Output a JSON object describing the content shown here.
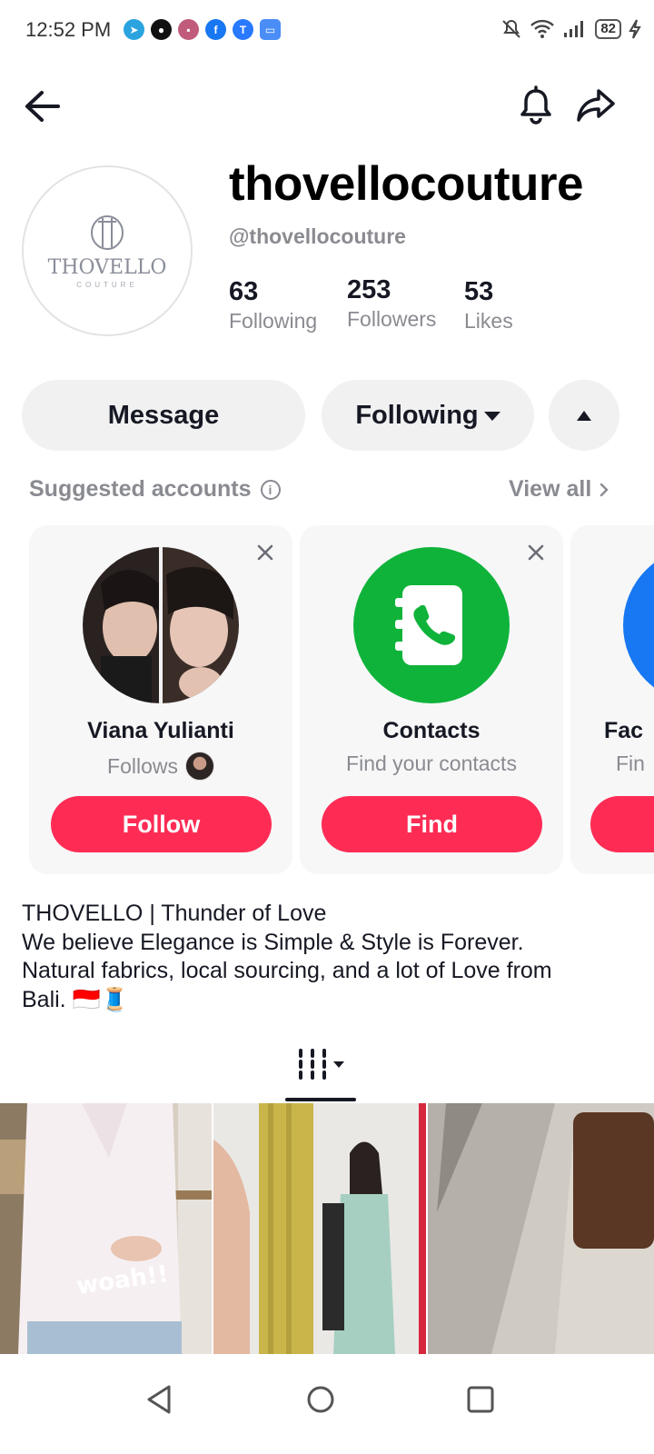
{
  "status_bar": {
    "time": "12:52 PM",
    "battery": "82",
    "apps": [
      {
        "icon": "telegram-icon",
        "color": "#2aa3df",
        "glyph": "➤"
      },
      {
        "icon": "app-icon",
        "color": "#111111",
        "glyph": "●"
      },
      {
        "icon": "app-icon",
        "color": "#c05b7b",
        "glyph": "▪"
      },
      {
        "icon": "facebook-icon",
        "color": "#1877f2",
        "glyph": "f"
      },
      {
        "icon": "app-icon",
        "color": "#2979ff",
        "glyph": "T"
      },
      {
        "icon": "app-icon",
        "color": "#4a8df6",
        "glyph": "▭"
      }
    ]
  },
  "profile": {
    "logo_mark": "ⓘ",
    "logo_name": "THOVELLO",
    "logo_sub": "COUTURE",
    "display_name": "thovellocouture",
    "handle": "@thovellocouture",
    "stats": [
      {
        "value": "63",
        "label": "Following"
      },
      {
        "value": "253",
        "label": "Followers"
      },
      {
        "value": "53",
        "label": "Likes"
      }
    ]
  },
  "actions": {
    "message_label": "Message",
    "following_label": "Following"
  },
  "suggested": {
    "title": "Suggested accounts",
    "view_all": "View all",
    "cards": [
      {
        "name": "Viana Yulianti",
        "sub": "Follows",
        "button": "Follow"
      },
      {
        "name": "Contacts",
        "sub": "Find your contacts",
        "button": "Find"
      },
      {
        "name": "Fac",
        "sub": "Fin",
        "button": ""
      }
    ]
  },
  "bio": {
    "lines": [
      "THOVELLO | Thunder of Love",
      "We believe Elegance is Simple & Style is Forever.",
      "Natural fabrics, local sourcing, and a lot of Love from",
      "Bali. 🇮🇩🧵"
    ]
  },
  "videos": [
    {
      "caption": "woah!!"
    },
    {
      "caption": ""
    },
    {
      "caption": ""
    }
  ],
  "colors": {
    "accent": "#fe2c55",
    "contacts_green": "#0fb33a",
    "muted_text": "#8a8b91"
  }
}
